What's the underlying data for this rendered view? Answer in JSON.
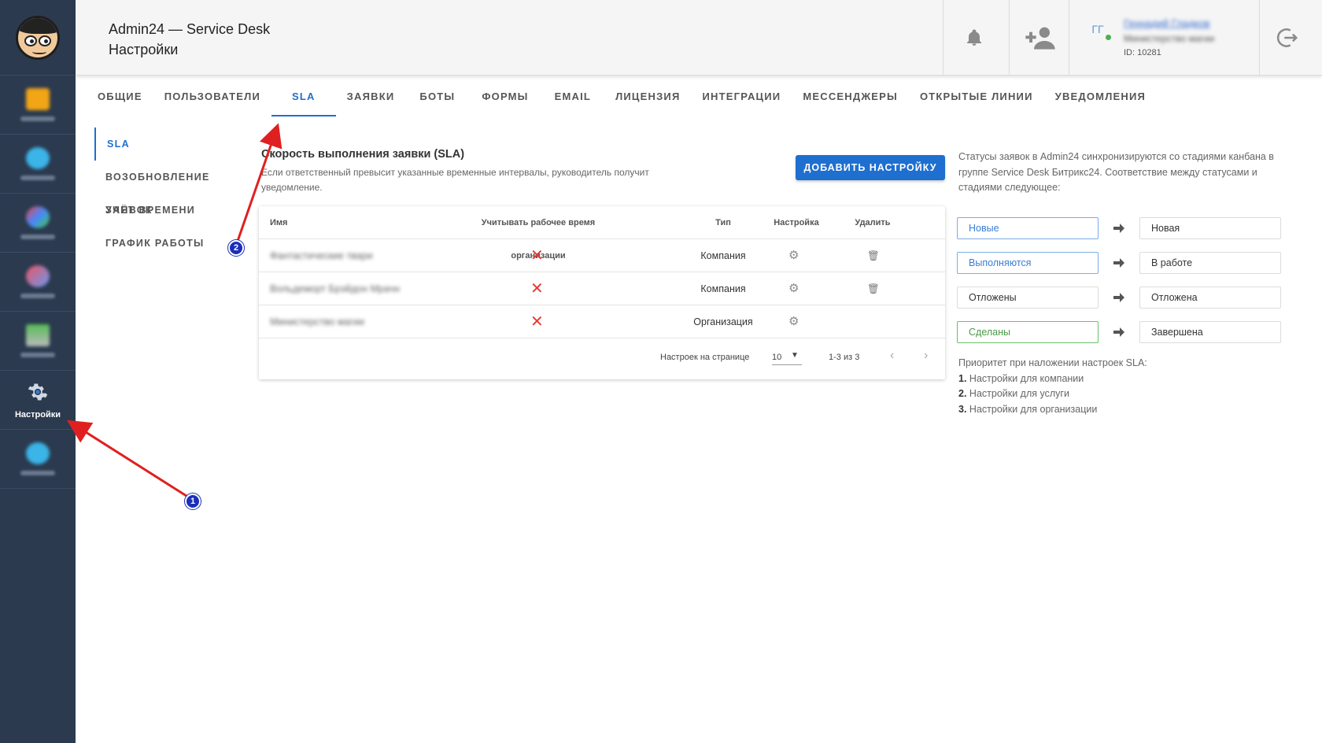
{
  "header": {
    "title": "Admin24 — Service Desk",
    "subtitle": "Настройки",
    "user": {
      "initials": "ГГ",
      "name": "Геннадий Гладков",
      "org": "Министерство магии",
      "id": "ID: 10281"
    }
  },
  "rail": {
    "active_label": "Настройки"
  },
  "tabs": [
    "ОБЩИЕ",
    "ПОЛЬЗОВАТЕЛИ",
    "SLA",
    "ЗАЯВКИ",
    "БОТЫ",
    "ФОРМЫ",
    "EMAIL",
    "ЛИЦЕНЗИЯ",
    "ИНТЕГРАЦИИ",
    "МЕССЕНДЖЕРЫ",
    "ОТКРЫТЫЕ ЛИНИИ",
    "УВЕДОМЛЕНИЯ"
  ],
  "subnav": [
    "SLA",
    "ВОЗОБНОВЛЕНИЕ ЗАЯВОК",
    "УЧЁТ ВРЕМЕНИ",
    "ГРАФИК РАБОТЫ"
  ],
  "main": {
    "title": "Скорость выполнения заявки (SLA)",
    "desc": "Если ответственный превысит указанные временные интервалы, руководитель получит уведомление.",
    "add_button": "ДОБАВИТЬ НАСТРОЙКУ"
  },
  "table": {
    "headers": [
      "Имя",
      "Учитывать рабочее время организации",
      "Тип",
      "Настройка",
      "Удалить"
    ],
    "rows": [
      {
        "name": "Фантастические твари",
        "type": "Компания",
        "work_time": "✕"
      },
      {
        "name": "Вольдеморт Брэйдон Мрачн",
        "type": "Компания",
        "work_time": "✕"
      },
      {
        "name": "Министерство магии",
        "type": "Организация",
        "work_time": "✕"
      }
    ],
    "per_page_label": "Настроек на странице",
    "per_page_value": "10",
    "range": "1-3 из 3"
  },
  "info": {
    "text": "Статусы заявок в Admin24 синхронизируются со стадиями канбана в группе Service Desk Битрикс24. Соответствие между статусами и стадиями следующее:",
    "mapping": [
      {
        "status": "Новые",
        "stage": "Новая"
      },
      {
        "status": "Выполняются",
        "stage": "В работе"
      },
      {
        "status": "Отложены",
        "stage": "Отложена"
      },
      {
        "status": "Сделаны",
        "stage": "Завершена"
      }
    ],
    "priority_title": "Приоритет при наложении настроек SLA:",
    "priority": [
      {
        "num": "1.",
        "text": "Настройки для компании"
      },
      {
        "num": "2.",
        "text": "Настройки для услуги"
      },
      {
        "num": "3.",
        "text": "Настройки для организации"
      }
    ]
  },
  "annotations": {
    "badge1": "1",
    "badge2": "2"
  },
  "colors": {
    "accent": "#1e6fd0",
    "rail": "#2b3a4f",
    "error": "#e53935",
    "annotation": "#e02020"
  }
}
